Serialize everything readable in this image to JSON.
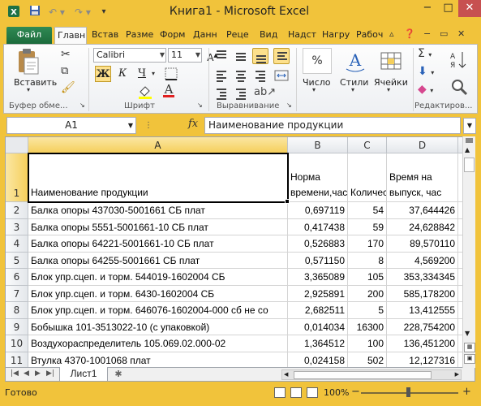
{
  "title": "Книга1 - Microsoft Excel",
  "quick_access": [
    "save-icon",
    "undo-icon",
    "redo-icon"
  ],
  "window": {
    "minimize": "−",
    "restore": "□",
    "close": "✕"
  },
  "tabs": [
    "Файл",
    "Главн",
    "Встав",
    "Разме",
    "Форм",
    "Данн",
    "Реце",
    "Вид",
    "Надст",
    "Нагру",
    "Рабоч"
  ],
  "ribbon": {
    "clipboard": {
      "paste": "Вставить",
      "group": "Буфер обме..."
    },
    "font": {
      "name": "Calibri",
      "size": "11",
      "bold": "Ж",
      "italic": "К",
      "underline": "Ч",
      "group": "Шрифт"
    },
    "alignment": {
      "group": "Выравнивание"
    },
    "number": {
      "label": "Число",
      "symbol": "%"
    },
    "styles": {
      "label": "Стили"
    },
    "cells": {
      "label": "Ячейки"
    },
    "editing": {
      "group": "Редактиров..."
    }
  },
  "formula_bar": {
    "name_box": "A1",
    "fx": "fx",
    "content": "Наименование продукции"
  },
  "columns": [
    "A",
    "B",
    "C",
    "D"
  ],
  "header_row": {
    "num": "1",
    "a": "Наименование продукции",
    "b": "Норма времени,час",
    "c": "Количество",
    "d": "Время на выпуск, час"
  },
  "rows": [
    {
      "num": "2",
      "a": "Балка опоры 437030-5001661 СБ плат",
      "b": "0,697119",
      "c": "54",
      "d": "37,644426"
    },
    {
      "num": "3",
      "a": "Балка опоры 5551-5001661-10 СБ плат",
      "b": "0,417438",
      "c": "59",
      "d": "24,628842"
    },
    {
      "num": "4",
      "a": "Балка опоры 64221-5001661-10 СБ плат",
      "b": "0,526883",
      "c": "170",
      "d": "89,570110"
    },
    {
      "num": "5",
      "a": "Балка опоры 64255-5001661 СБ плат",
      "b": "0,571150",
      "c": "8",
      "d": "4,569200"
    },
    {
      "num": "6",
      "a": "Блок упр.сцеп. и торм. 544019-1602004 СБ",
      "b": "3,365089",
      "c": "105",
      "d": "353,334345"
    },
    {
      "num": "7",
      "a": "Блок упр.сцеп. и торм. 6430-1602004 СБ",
      "b": "2,925891",
      "c": "200",
      "d": "585,178200"
    },
    {
      "num": "8",
      "a": "Блок упр.сцеп. и торм. 646076-1602004-000 сб не со",
      "b": "2,682511",
      "c": "5",
      "d": "13,412555"
    },
    {
      "num": "9",
      "a": "Бобышка 101-3513022-10 (с упаковкой)",
      "b": "0,014034",
      "c": "16300",
      "d": "228,754200"
    },
    {
      "num": "10",
      "a": "Воздухораспределитель 105.069.02.000-02",
      "b": "1,364512",
      "c": "100",
      "d": "136,451200"
    },
    {
      "num": "11",
      "a": "Втулка 4370-1001068 плат",
      "b": "0,024158",
      "c": "502",
      "d": "12,127316"
    }
  ],
  "sheet_tab": "Лист1",
  "status": {
    "ready": "Готово",
    "zoom": "100%"
  }
}
